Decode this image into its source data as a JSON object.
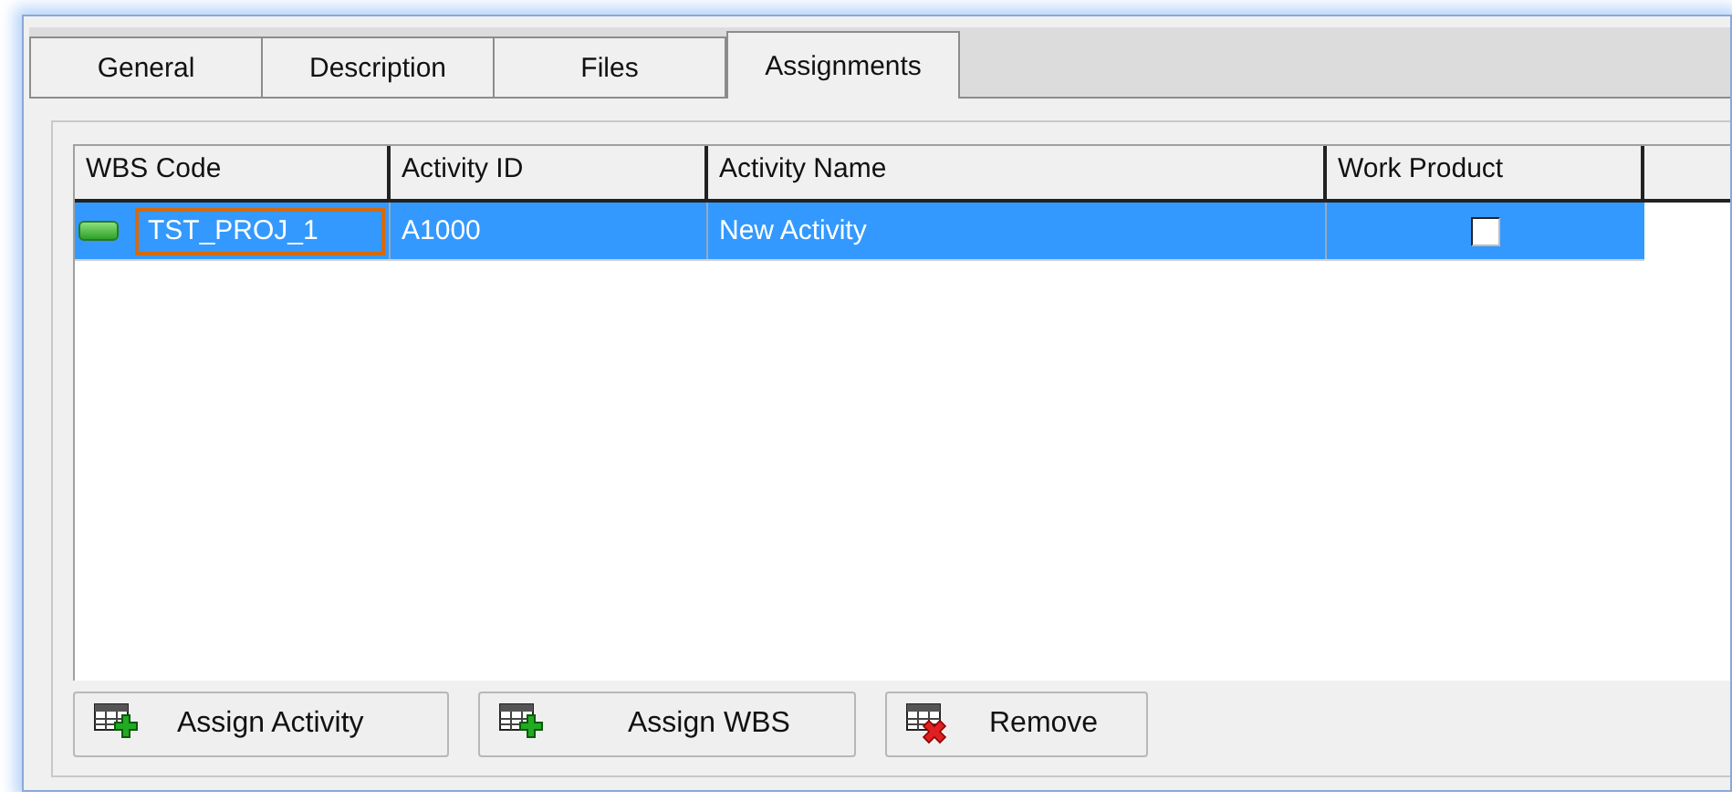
{
  "tabs": [
    {
      "label": "General",
      "selected": false
    },
    {
      "label": "Description",
      "selected": false
    },
    {
      "label": "Files",
      "selected": false
    },
    {
      "label": "Assignments",
      "selected": true
    }
  ],
  "grid": {
    "columns": [
      "WBS Code",
      "Activity ID",
      "Activity Name",
      "Work Product"
    ],
    "rows": [
      {
        "wbs_code": "TST_PROJ_1",
        "activity_id": "A1000",
        "activity_name": "New Activity",
        "work_product": false,
        "selected": true
      }
    ]
  },
  "buttons": [
    {
      "label": "Assign Activity",
      "kind": "add"
    },
    {
      "label": "Assign WBS",
      "kind": "add"
    },
    {
      "label": "Remove",
      "kind": "remove"
    }
  ]
}
